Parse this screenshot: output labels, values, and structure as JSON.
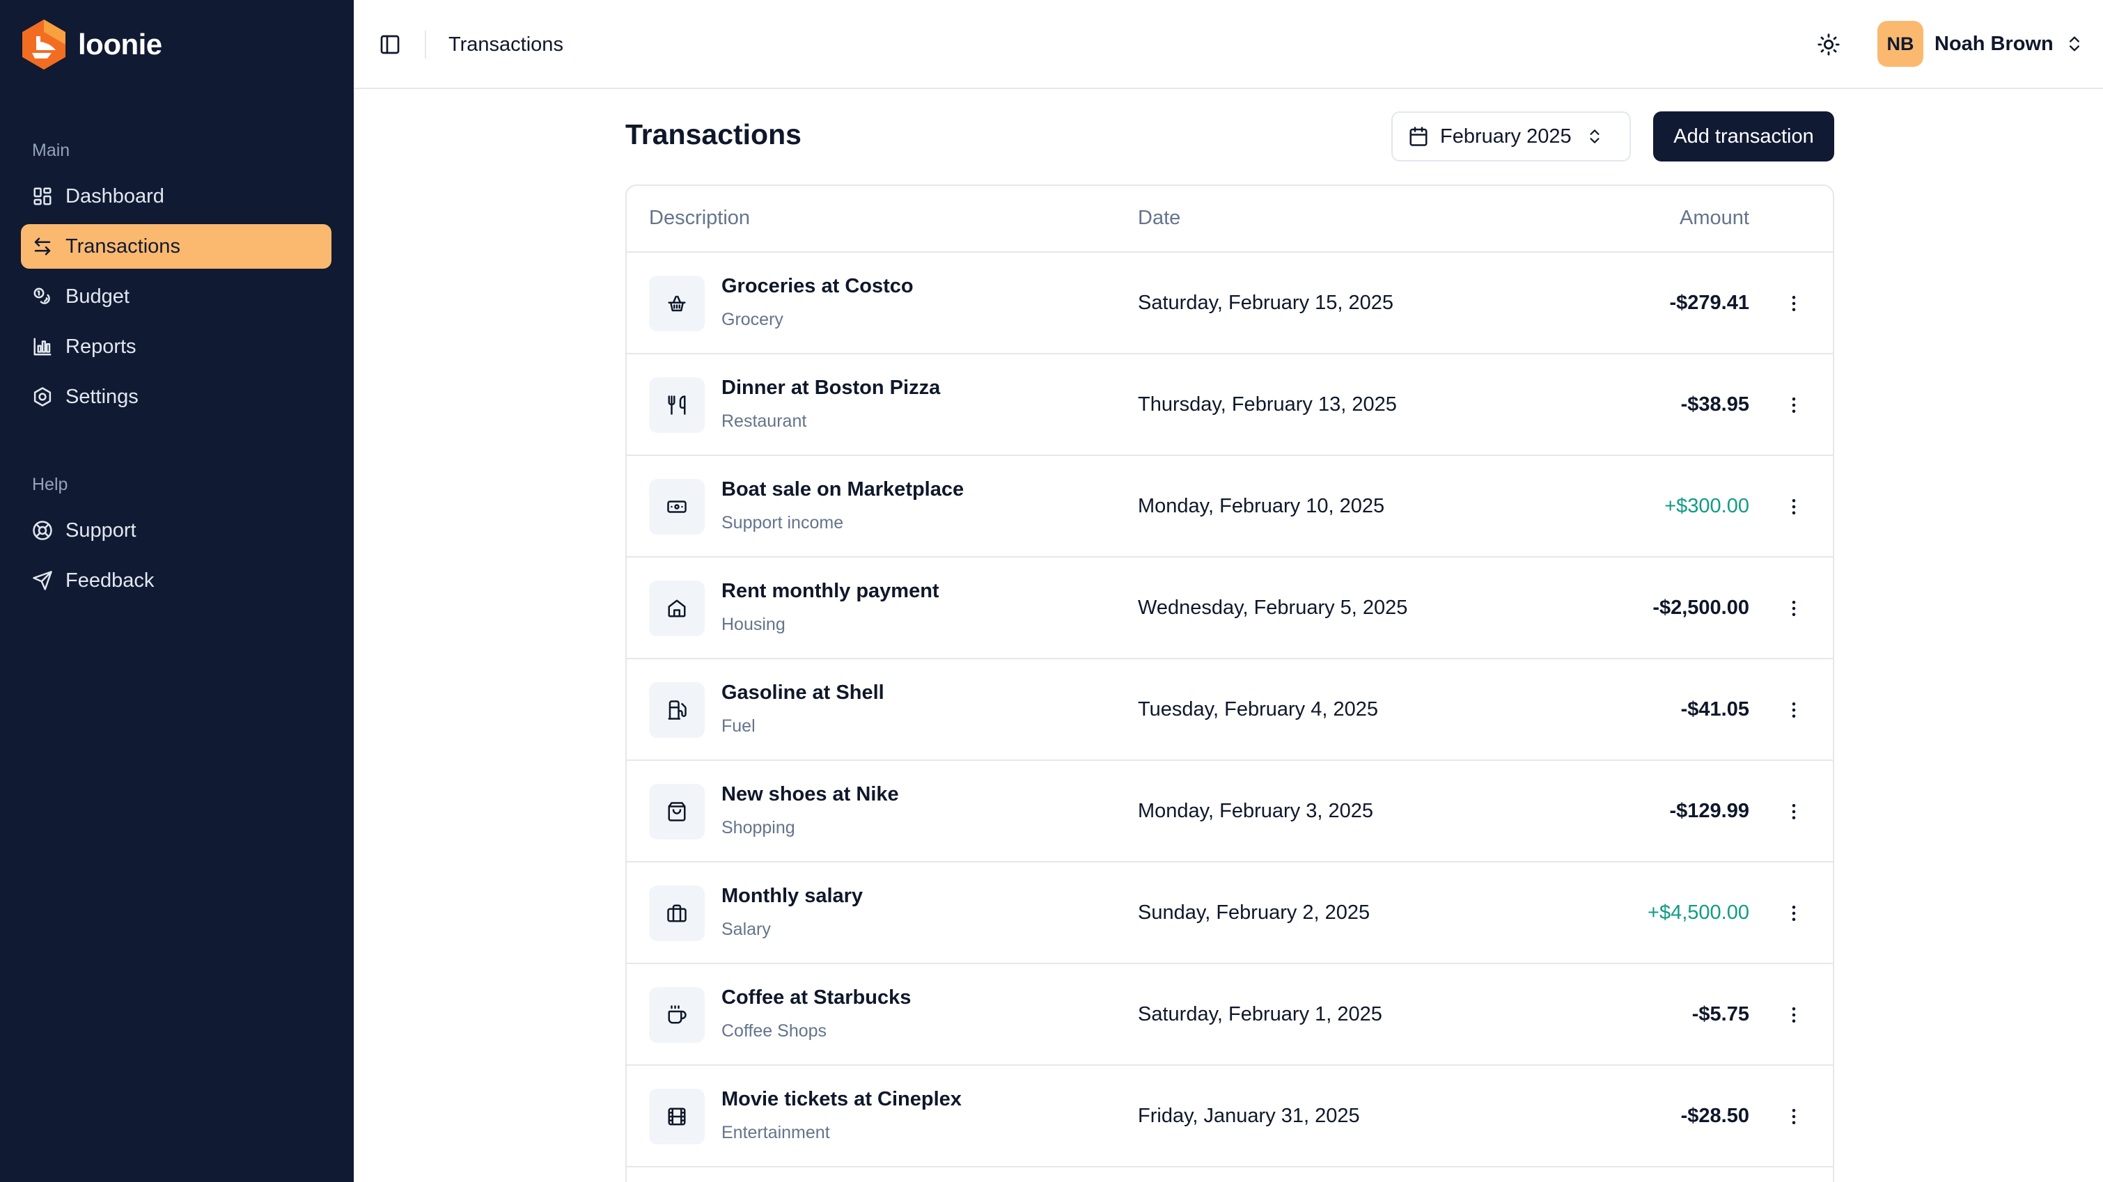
{
  "app": {
    "name": "loonie",
    "logo_icon": "loonie-logo-icon",
    "accent": "#fbb96f",
    "sidebar_bg": "#111a33"
  },
  "sidebar": {
    "sections": [
      {
        "label": "Main"
      },
      {
        "label": "Help"
      }
    ],
    "items": [
      {
        "label": "Dashboard",
        "icon": "layout-grid-icon"
      },
      {
        "label": "Transactions",
        "icon": "arrows-exchange-icon",
        "active": true
      },
      {
        "label": "Budget",
        "icon": "coins-icon"
      },
      {
        "label": "Reports",
        "icon": "bar-chart-icon"
      },
      {
        "label": "Settings",
        "icon": "gear-icon"
      },
      {
        "label": "Support",
        "icon": "lifebuoy-icon"
      },
      {
        "label": "Feedback",
        "icon": "send-icon"
      }
    ]
  },
  "header": {
    "title": "Transactions",
    "toggle_icon": "sidebar-toggle-icon",
    "theme_icon": "sun-icon",
    "user": {
      "initials": "NB",
      "name": "Noah Brown"
    }
  },
  "main": {
    "title": "Transactions",
    "month_picker": {
      "value": "February 2025"
    },
    "add_button_label": "Add transaction",
    "columns": {
      "description": "Description",
      "date": "Date",
      "amount": "Amount"
    },
    "positive_color": "#0f9c84",
    "rows": [
      {
        "title": "Groceries at Costco",
        "category": "Grocery",
        "date": "Saturday, February 15, 2025",
        "amount": "-$279.41",
        "icon": "basket-icon"
      },
      {
        "title": "Dinner at Boston Pizza",
        "category": "Restaurant",
        "date": "Thursday, February 13, 2025",
        "amount": "-$38.95",
        "icon": "utensils-icon"
      },
      {
        "title": "Boat sale on Marketplace",
        "category": "Support income",
        "date": "Monday, February 10, 2025",
        "amount": "+$300.00",
        "icon": "banknote-icon"
      },
      {
        "title": "Rent monthly payment",
        "category": "Housing",
        "date": "Wednesday, February 5, 2025",
        "amount": "-$2,500.00",
        "icon": "home-icon"
      },
      {
        "title": "Gasoline at Shell",
        "category": "Fuel",
        "date": "Tuesday, February 4, 2025",
        "amount": "-$41.05",
        "icon": "fuel-icon"
      },
      {
        "title": "New shoes at Nike",
        "category": "Shopping",
        "date": "Monday, February 3, 2025",
        "amount": "-$129.99",
        "icon": "shopping-bag-icon"
      },
      {
        "title": "Monthly salary",
        "category": "Salary",
        "date": "Sunday, February 2, 2025",
        "amount": "+$4,500.00",
        "icon": "briefcase-icon"
      },
      {
        "title": "Coffee at Starbucks",
        "category": "Coffee Shops",
        "date": "Saturday, February 1, 2025",
        "amount": "-$5.75",
        "icon": "coffee-icon"
      },
      {
        "title": "Movie tickets at Cineplex",
        "category": "Entertainment",
        "date": "Friday, January 31, 2025",
        "amount": "-$28.50",
        "icon": "film-icon"
      }
    ]
  }
}
